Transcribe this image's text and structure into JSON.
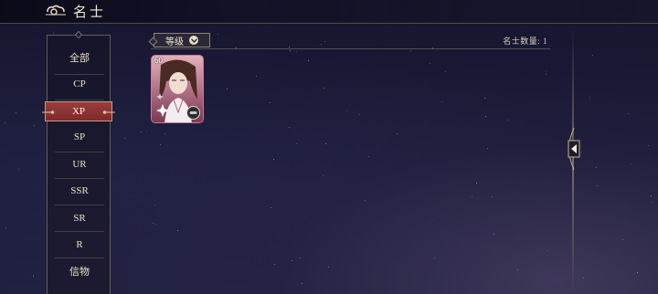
{
  "header": {
    "title": "名士",
    "icon": "cloud-emblem-icon"
  },
  "tabs": [
    {
      "label": "全部",
      "active": false
    },
    {
      "label": "CP",
      "active": false
    },
    {
      "label": "XP",
      "active": true
    },
    {
      "label": "SP",
      "active": false
    },
    {
      "label": "UR",
      "active": false
    },
    {
      "label": "SSR",
      "active": false
    },
    {
      "label": "SR",
      "active": false
    },
    {
      "label": "R",
      "active": false
    },
    {
      "label": "信物",
      "active": false
    }
  ],
  "sort": {
    "label": "等级",
    "icon": "chevron-down-icon"
  },
  "count_text": "名士数量: 1",
  "cards": [
    {
      "level": "60",
      "badge_icon": "token-badge-icon"
    }
  ],
  "colors": {
    "accent_gold": "#c8b48c",
    "active_tab": "#8a3236",
    "card_frame": "#c97a9a"
  }
}
